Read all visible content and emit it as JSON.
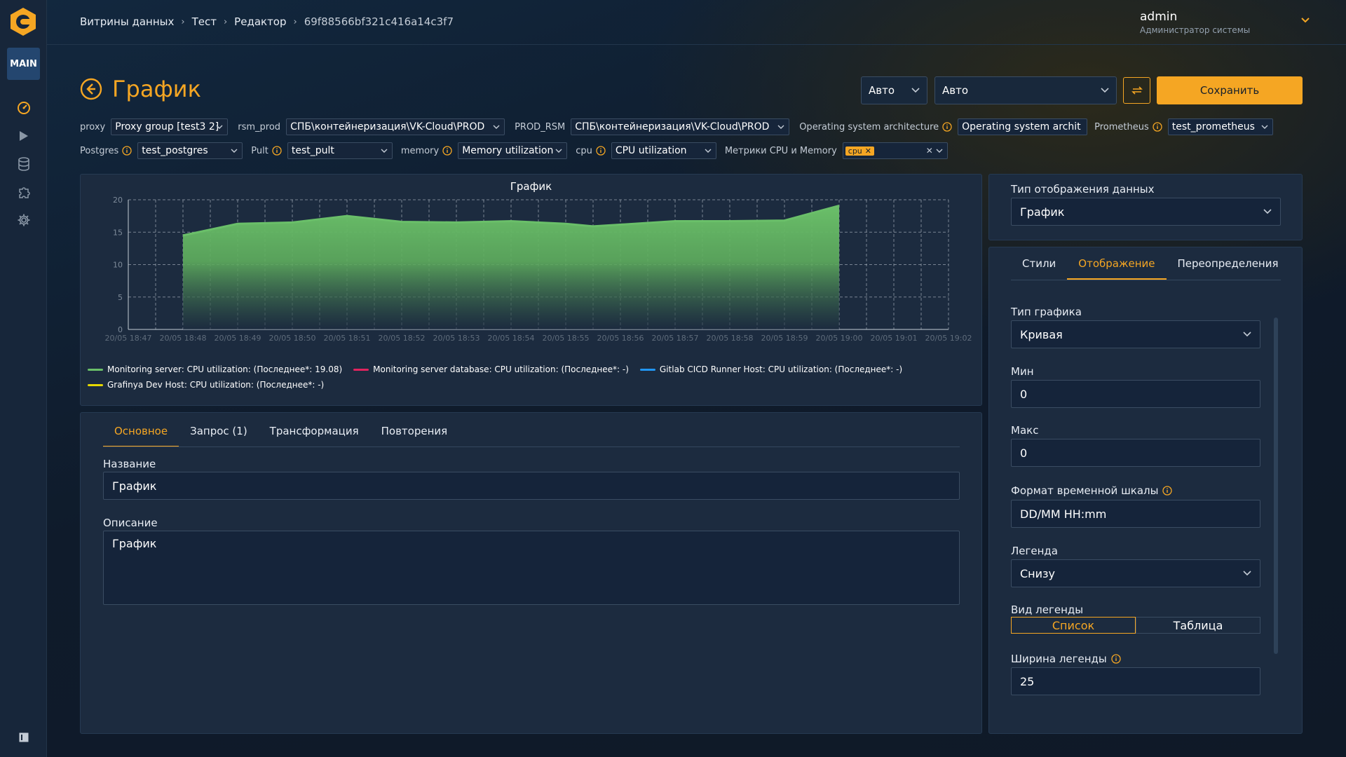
{
  "sidebar": {
    "badge": "MAIN",
    "icons": [
      "dashboard-icon",
      "play-icon",
      "database-icon",
      "puzzle-icon",
      "gear-icon"
    ],
    "bottom_icon": "panel-toggle-icon"
  },
  "breadcrumbs": [
    "Витрины данных",
    "Тест",
    "Редактор",
    "69f88566bf321c416a14c3f7"
  ],
  "user": {
    "name": "admin",
    "role": "Администратор системы"
  },
  "page": {
    "title": "График"
  },
  "toolbar": {
    "interval": "Авто",
    "refresh": "Авто",
    "save": "Сохранить"
  },
  "variables": {
    "row1": [
      {
        "label": "proxy",
        "value": "Proxy group [test3 2]",
        "info": false
      },
      {
        "label": "rsm_prod",
        "value": "СПБ\\контейнеризация\\VK-Cloud\\PROD",
        "info": false
      },
      {
        "label": "PROD_RSM",
        "value": "СПБ\\контейнеризация\\VK-Cloud\\PROD",
        "info": false
      },
      {
        "label": "Operating system architecture",
        "value": "Operating system archit",
        "info": true
      },
      {
        "label": "Prometheus",
        "value": "test_prometheus",
        "info": true
      }
    ],
    "row2": [
      {
        "label": "Postgres",
        "value": "test_postgres",
        "info": true
      },
      {
        "label": "Pult",
        "value": "test_pult",
        "info": true
      },
      {
        "label": "memory",
        "value": "Memory utilization",
        "info": true
      },
      {
        "label": "cpu",
        "value": "CPU utilization",
        "info": true
      },
      {
        "label": "Метрики CPU и Memory",
        "chip": "cpu",
        "info": false
      }
    ]
  },
  "chart_data": {
    "type": "area",
    "title": "График",
    "x": [
      "20/05 18:47",
      "20/05 18:48",
      "20/05 18:49",
      "20/05 18:50",
      "20/05 18:51",
      "20/05 18:52",
      "20/05 18:53",
      "20/05 18:54",
      "20/05 18:55",
      "20/05 18:56",
      "20/05 18:57",
      "20/05 18:58",
      "20/05 18:59",
      "20/05 19:00",
      "20/05 19:01",
      "20/05 19:02"
    ],
    "ylim": [
      0,
      20
    ],
    "yticks": [
      0,
      5,
      10,
      15,
      20
    ],
    "grid": true,
    "legend_position": "bottom",
    "series": [
      {
        "name": "Monitoring server: CPU utilization: (Последнее*: 19.08)",
        "color": "#6abf69",
        "points": [
          {
            "x": "20/05 18:48",
            "y": 14.5
          },
          {
            "x": "20/05 18:49",
            "y": 16.3
          },
          {
            "x": "20/05 18:50",
            "y": 16.5
          },
          {
            "x": "20/05 18:51",
            "y": 17.5
          },
          {
            "x": "20/05 18:52",
            "y": 16.6
          },
          {
            "x": "20/05 18:53",
            "y": 16.5
          },
          {
            "x": "20/05 18:54",
            "y": 16.7
          },
          {
            "x": "20/05 18:55",
            "y": 16.3
          },
          {
            "x": "20/05 18:55:30",
            "y": 15.9
          },
          {
            "x": "20/05 18:57",
            "y": 16.7
          },
          {
            "x": "20/05 18:58",
            "y": 16.7
          },
          {
            "x": "20/05 18:59",
            "y": 16.8
          },
          {
            "x": "20/05 19:00",
            "y": 19.08
          }
        ]
      },
      {
        "name": "Monitoring server database: CPU utilization: (Последнее*: -)",
        "color": "#e0245e",
        "points": []
      },
      {
        "name": "Gitlab CICD Runner Host: CPU utilization: (Последнее*: -)",
        "color": "#2196f3",
        "points": []
      },
      {
        "name": "Grafinya Dev Host: CPU utilization: (Последнее*: -)",
        "color": "#e6d800",
        "points": []
      }
    ]
  },
  "editor": {
    "tabs": [
      "Основное",
      "Запрос (1)",
      "Трансформация",
      "Повторения"
    ],
    "name_label": "Название",
    "name_value": "График",
    "desc_label": "Описание",
    "desc_value": "График"
  },
  "display_type": {
    "label": "Тип отображения данных",
    "value": "График"
  },
  "options": {
    "tabs": [
      "Стили",
      "Отображение",
      "Переопределения"
    ],
    "chart_type_label": "Тип графика",
    "chart_type": "Кривая",
    "min_label": "Мин",
    "min": "0",
    "max_label": "Макс",
    "max": "0",
    "time_format_label": "Формат временной шкалы",
    "time_format": "DD/MM HH:mm",
    "legend_label": "Легенда",
    "legend": "Снизу",
    "legend_view_label": "Вид легенды",
    "legend_view": [
      "Список",
      "Таблица"
    ],
    "legend_width_label": "Ширина легенды",
    "legend_width": "25"
  },
  "colors": {
    "accent": "#f5a623",
    "panel": "#1c2b3f",
    "series_green": "#6abf69"
  }
}
